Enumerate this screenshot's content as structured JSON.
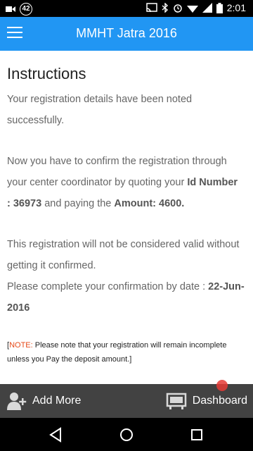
{
  "status_bar": {
    "notification_count": "42",
    "time": "2:01"
  },
  "app_bar": {
    "title": "MMHT Jatra 2016",
    "menu_icon": "hamburger-menu-icon"
  },
  "content": {
    "heading": "Instructions",
    "para1": "Your registration details have been noted successfully.",
    "para2_prefix": "Now you have to confirm the registration through your center coordinator by quoting your ",
    "id_label": "Id Number",
    "id_value": ": 36973",
    "para2_middle": " and paying the ",
    "amount_label": "Amount: 4600.",
    "para3": "This registration will not be considered valid without getting it confirmed.",
    "para4_prefix": "Please complete your confirmation by date : ",
    "confirm_date": "22-Jun-2016",
    "note_open": "[",
    "note_tag": "NOTE:",
    "note_text": " Please note that your registration will remain incomplete unless you Pay the deposit amount.]"
  },
  "bottom_bar": {
    "add_more_label": "Add More",
    "dashboard_label": "Dashboard"
  },
  "colors": {
    "app_bar": "#2196F3",
    "bottom_bar": "#424242",
    "note_tag": "#e64a19"
  }
}
